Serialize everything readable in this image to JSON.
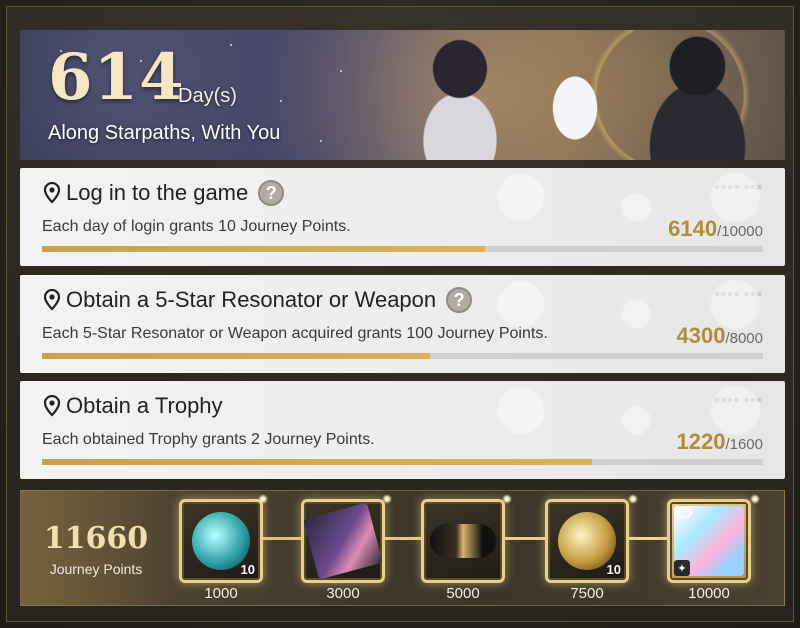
{
  "banner": {
    "days": "614",
    "days_unit": "Day(s)",
    "subtitle": "Along Starpaths, With You"
  },
  "tasks": [
    {
      "title": "Log in to the game",
      "has_help": true,
      "description": "Each day of login grants 10 Journey Points.",
      "current": "6140",
      "max": "/10000",
      "progress": 0.614
    },
    {
      "title": "Obtain a 5-Star Resonator or Weapon",
      "has_help": true,
      "description": "Each 5-Star Resonator or Weapon acquired grants 100 Journey Points.",
      "current": "4300",
      "max": "/8000",
      "progress": 0.5375
    },
    {
      "title": "Obtain a Trophy",
      "has_help": false,
      "description": "Each obtained Trophy grants 2 Journey Points.",
      "current": "1220",
      "max": "/1600",
      "progress": 0.7625
    }
  ],
  "rewards_panel": {
    "points": "11660",
    "points_label": "Journey Points",
    "rewards": [
      {
        "threshold": "1000",
        "qty": "10",
        "icon": "teal-orb-icon"
      },
      {
        "threshold": "3000",
        "qty": "",
        "icon": "card-ticket-icon"
      },
      {
        "threshold": "5000",
        "qty": "",
        "icon": "device-icon"
      },
      {
        "threshold": "7500",
        "qty": "10",
        "icon": "gold-orb-icon"
      },
      {
        "threshold": "10000",
        "qty": "",
        "icon": "wings-icon"
      }
    ]
  },
  "colors": {
    "accent_gold": "#c9a24f",
    "progress_track": "#cfcfcf",
    "card_bg": "#f3f3f3"
  }
}
